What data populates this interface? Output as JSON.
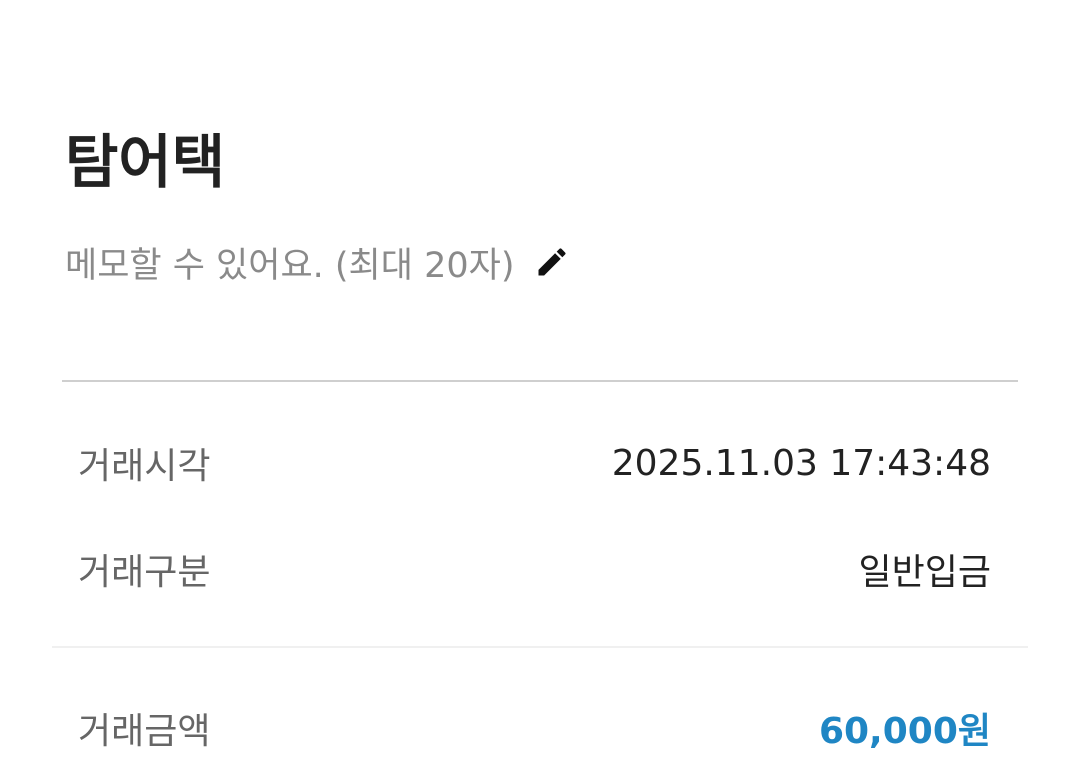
{
  "header": {
    "title": "탐어택",
    "memo_placeholder": "메모할 수 있어요. (최대 20자)",
    "memo_icon": "pencil-icon"
  },
  "details": {
    "time": {
      "label": "거래시각",
      "value": "2025.11.03 17:43:48"
    },
    "type": {
      "label": "거래구분",
      "value": "일반입금"
    },
    "amount": {
      "label": "거래금액",
      "value": "60,000원"
    }
  },
  "colors": {
    "amount": "#1f86c4",
    "label": "#666666",
    "value": "#222222",
    "memo": "#8a8a8a"
  }
}
